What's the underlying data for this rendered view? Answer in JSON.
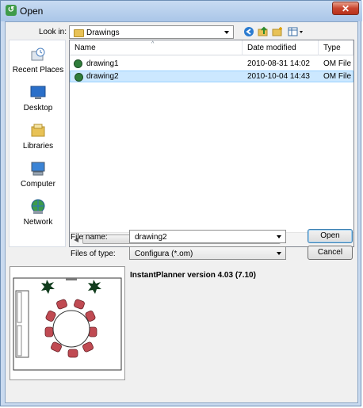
{
  "window": {
    "title": "Open",
    "close_label": "✕"
  },
  "toolbar": {
    "look_in_label": "Look in:",
    "look_in_value": "Drawings",
    "icons": [
      "back-icon",
      "up-folder-icon",
      "new-folder-icon",
      "view-menu-icon"
    ]
  },
  "places": [
    {
      "label": "Recent Places",
      "icon": "recent-places-icon"
    },
    {
      "label": "Desktop",
      "icon": "desktop-icon"
    },
    {
      "label": "Libraries",
      "icon": "libraries-icon"
    },
    {
      "label": "Computer",
      "icon": "computer-icon"
    },
    {
      "label": "Network",
      "icon": "network-icon"
    }
  ],
  "file_list": {
    "columns": [
      "Name",
      "Date modified",
      "Type"
    ],
    "rows": [
      {
        "name": "drawing1",
        "date": "2010-08-31 14:02",
        "type": "OM File",
        "selected": false
      },
      {
        "name": "drawing2",
        "date": "2010-10-04 14:43",
        "type": "OM File",
        "selected": true
      }
    ],
    "scroll_grip": "III"
  },
  "form": {
    "file_name_label": "File name:",
    "file_name_value": "drawing2",
    "file_type_label": "Files of type:",
    "file_type_value": "Configura (*.om)"
  },
  "buttons": {
    "open": "Open",
    "cancel": "Cancel"
  },
  "preview": {
    "version_text": "InstantPlanner version 4.03 (7.10)"
  },
  "colors": {
    "selection": "#cce8ff",
    "title_bar": "#b6cfee",
    "chair": "#c04a52",
    "plant": "#123d1e"
  }
}
